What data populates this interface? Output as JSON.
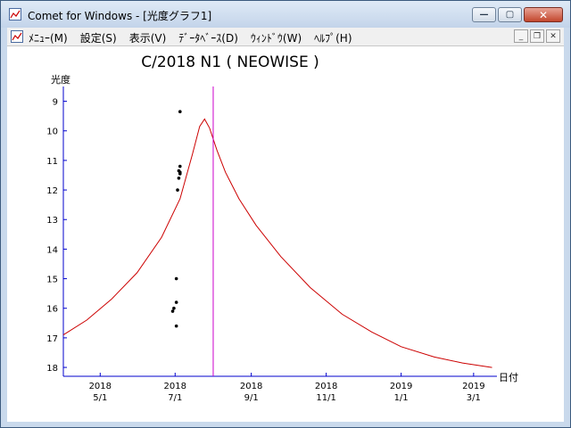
{
  "window": {
    "title": "Comet for Windows - [光度グラフ1]",
    "caption_min": "—",
    "caption_max": "▢",
    "caption_close": "✕"
  },
  "menubar": {
    "items": [
      "ﾒﾆｭｰ(M)",
      "設定(S)",
      "表示(V)",
      "ﾃﾞｰﾀﾍﾞｰｽ(D)",
      "ｳｨﾝﾄﾞｳ(W)",
      "ﾍﾙﾌﾟ(H)"
    ],
    "mdi_min": "_",
    "mdi_restore": "❐",
    "mdi_close": "✕"
  },
  "colors": {
    "curve": "#cc0000",
    "marker": "#cc00cc",
    "axis": "#0000cc",
    "points": "#000000"
  },
  "chart_data": {
    "type": "scatter",
    "title": "C/2018 N1 ( NEOWISE )",
    "ylabel": "光度",
    "xlabel": "日付",
    "ylim": [
      18.3,
      8.5
    ],
    "y_ticks": [
      9,
      10,
      11,
      12,
      13,
      14,
      15,
      16,
      17,
      18
    ],
    "x_ticks": [
      {
        "year": "2018",
        "md": "5/1",
        "date": "2018-05-01"
      },
      {
        "year": "2018",
        "md": "7/1",
        "date": "2018-07-01"
      },
      {
        "year": "2018",
        "md": "9/1",
        "date": "2018-09-01"
      },
      {
        "year": "2018",
        "md": "11/1",
        "date": "2018-11-01"
      },
      {
        "year": "2019",
        "md": "1/1",
        "date": "2019-01-01"
      },
      {
        "year": "2019",
        "md": "3/1",
        "date": "2019-03-01"
      }
    ],
    "xlim": [
      "2018-04-01",
      "2019-03-20"
    ],
    "marker_date": "2018-08-01",
    "predicted_curve": [
      {
        "x": "2018-04-01",
        "y": 16.9
      },
      {
        "x": "2018-04-20",
        "y": 16.4
      },
      {
        "x": "2018-05-10",
        "y": 15.7
      },
      {
        "x": "2018-05-31",
        "y": 14.8
      },
      {
        "x": "2018-06-20",
        "y": 13.6
      },
      {
        "x": "2018-07-05",
        "y": 12.3
      },
      {
        "x": "2018-07-15",
        "y": 10.8
      },
      {
        "x": "2018-07-21",
        "y": 9.85
      },
      {
        "x": "2018-07-25",
        "y": 9.6
      },
      {
        "x": "2018-07-29",
        "y": 9.9
      },
      {
        "x": "2018-08-04",
        "y": 10.65
      },
      {
        "x": "2018-08-11",
        "y": 11.4
      },
      {
        "x": "2018-08-22",
        "y": 12.3
      },
      {
        "x": "2018-09-05",
        "y": 13.2
      },
      {
        "x": "2018-09-25",
        "y": 14.25
      },
      {
        "x": "2018-10-19",
        "y": 15.3
      },
      {
        "x": "2018-11-14",
        "y": 16.2
      },
      {
        "x": "2018-12-08",
        "y": 16.8
      },
      {
        "x": "2019-01-01",
        "y": 17.3
      },
      {
        "x": "2019-01-28",
        "y": 17.65
      },
      {
        "x": "2019-02-20",
        "y": 17.85
      },
      {
        "x": "2019-03-16",
        "y": 18.0
      }
    ],
    "observations": [
      {
        "x": "2018-07-05",
        "y": 9.35
      },
      {
        "x": "2018-07-05",
        "y": 11.2
      },
      {
        "x": "2018-07-04",
        "y": 11.35
      },
      {
        "x": "2018-07-05",
        "y": 11.4
      },
      {
        "x": "2018-07-05",
        "y": 11.45
      },
      {
        "x": "2018-07-04",
        "y": 11.6
      },
      {
        "x": "2018-07-03",
        "y": 12.0
      },
      {
        "x": "2018-07-02",
        "y": 15.0
      },
      {
        "x": "2018-07-02",
        "y": 15.8
      },
      {
        "x": "2018-06-30",
        "y": 16.0
      },
      {
        "x": "2018-06-29",
        "y": 16.1
      },
      {
        "x": "2018-07-02",
        "y": 16.6
      }
    ]
  }
}
